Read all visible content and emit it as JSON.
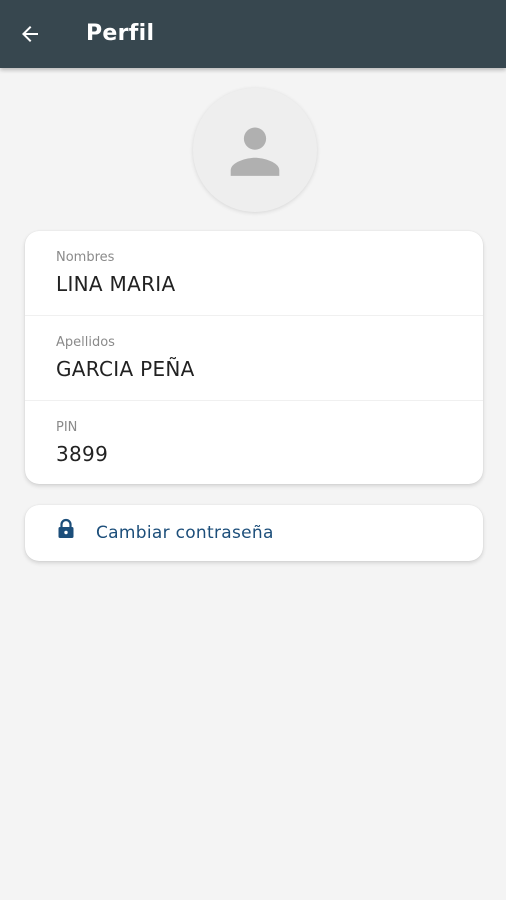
{
  "header": {
    "title": "Perfil",
    "back_icon": "arrow-left-icon",
    "background_color": "#37474f"
  },
  "avatar": {
    "icon": "person-icon"
  },
  "profile": {
    "fields": [
      {
        "label": "Nombres",
        "value": "LINA MARIA"
      },
      {
        "label": "Apellidos",
        "value": "GARCIA PEÑA"
      },
      {
        "label": "PIN",
        "value": "3899"
      }
    ]
  },
  "actions": {
    "change_password_label": "Cambiar contraseña",
    "change_password_icon": "lock-icon",
    "accent_color": "#1c4e7a"
  }
}
